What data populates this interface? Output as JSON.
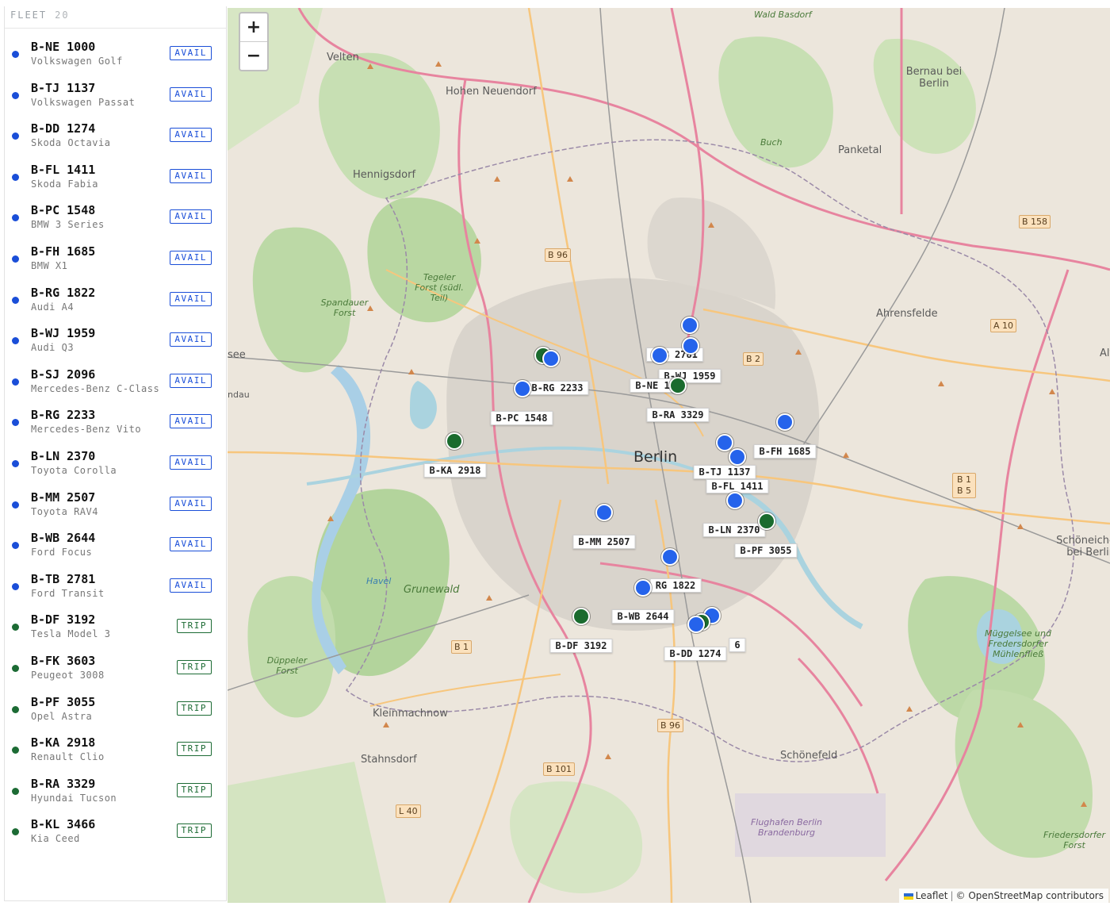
{
  "sidebar": {
    "title": "FLEET",
    "count": "20",
    "vehicles": [
      {
        "plate": "B-NE 1000",
        "model": "Volkswagen Golf",
        "status": "AVAIL"
      },
      {
        "plate": "B-TJ 1137",
        "model": "Volkswagen Passat",
        "status": "AVAIL"
      },
      {
        "plate": "B-DD 1274",
        "model": "Skoda Octavia",
        "status": "AVAIL"
      },
      {
        "plate": "B-FL 1411",
        "model": "Skoda Fabia",
        "status": "AVAIL"
      },
      {
        "plate": "B-PC 1548",
        "model": "BMW 3 Series",
        "status": "AVAIL"
      },
      {
        "plate": "B-FH 1685",
        "model": "BMW X1",
        "status": "AVAIL"
      },
      {
        "plate": "B-RG 1822",
        "model": "Audi A4",
        "status": "AVAIL"
      },
      {
        "plate": "B-WJ 1959",
        "model": "Audi Q3",
        "status": "AVAIL"
      },
      {
        "plate": "B-SJ 2096",
        "model": "Mercedes-Benz C-Class",
        "status": "AVAIL"
      },
      {
        "plate": "B-RG 2233",
        "model": "Mercedes-Benz Vito",
        "status": "AVAIL"
      },
      {
        "plate": "B-LN 2370",
        "model": "Toyota Corolla",
        "status": "AVAIL"
      },
      {
        "plate": "B-MM 2507",
        "model": "Toyota RAV4",
        "status": "AVAIL"
      },
      {
        "plate": "B-WB 2644",
        "model": "Ford Focus",
        "status": "AVAIL"
      },
      {
        "plate": "B-TB 2781",
        "model": "Ford Transit",
        "status": "AVAIL"
      },
      {
        "plate": "B-DF 3192",
        "model": "Tesla Model 3",
        "status": "TRIP"
      },
      {
        "plate": "B-FK 3603",
        "model": "Peugeot 3008",
        "status": "TRIP"
      },
      {
        "plate": "B-PF 3055",
        "model": "Opel Astra",
        "status": "TRIP"
      },
      {
        "plate": "B-KA 2918",
        "model": "Renault Clio",
        "status": "TRIP"
      },
      {
        "plate": "B-RA 3329",
        "model": "Hyundai Tucson",
        "status": "TRIP"
      },
      {
        "plate": "B-KL 3466",
        "model": "Kia Ceed",
        "status": "TRIP"
      }
    ]
  },
  "colors": {
    "avail": "#1a4ed8",
    "trip": "#1c6b34",
    "marker_avail": "#2563eb",
    "marker_trip": "#1a6b2e"
  },
  "map": {
    "zoom_in": "+",
    "zoom_out": "−",
    "attribution_leaflet": "Leaflet",
    "attribution_sep": "|",
    "attribution_osm": "© OpenStreetMap contributors",
    "place_labels": [
      "Velten",
      "Hohen Neuendorf",
      "Bernau bei Berlin",
      "Panketal",
      "Hennigsdorf",
      "Ahrensfelde",
      "Berlin",
      "Altl",
      "Schöneiche bei Berlin",
      "Grunewald",
      "Kleinmachnow",
      "Stahnsdorf",
      "Schönefeld",
      "Flughafen Berlin Brandenburg",
      "Müggelsee und Fredersdorfer Mühlenfließ",
      "Friedersdorfer Forst",
      "Tegeler Forst (südl. Teil)",
      "Spandauer Forst",
      "Düppeler Forst",
      "Wald Basdorf",
      "Buch",
      "Havel",
      "see",
      "ndau"
    ],
    "road_shields": [
      "B 96",
      "B 2",
      "B 158",
      "A 10",
      "B 1 B 5",
      "B 1",
      "B 96",
      "B 101",
      "L 40"
    ],
    "marker_labels": [
      "B-RG 2233",
      "-TB 2781",
      "B-WJ 1959",
      "B-NE 1",
      "B-PC 1548",
      "B-RA 3329",
      "B-FH 1685",
      "B-KA 2918",
      "B-TJ 1137",
      "B-FL 1411",
      "B-LN 2370",
      "B-MM 2507",
      "B-PF 3055",
      "RG 1822",
      "B-WB 2644",
      "B-DF 3192",
      "B-DD 1274",
      "6"
    ]
  }
}
